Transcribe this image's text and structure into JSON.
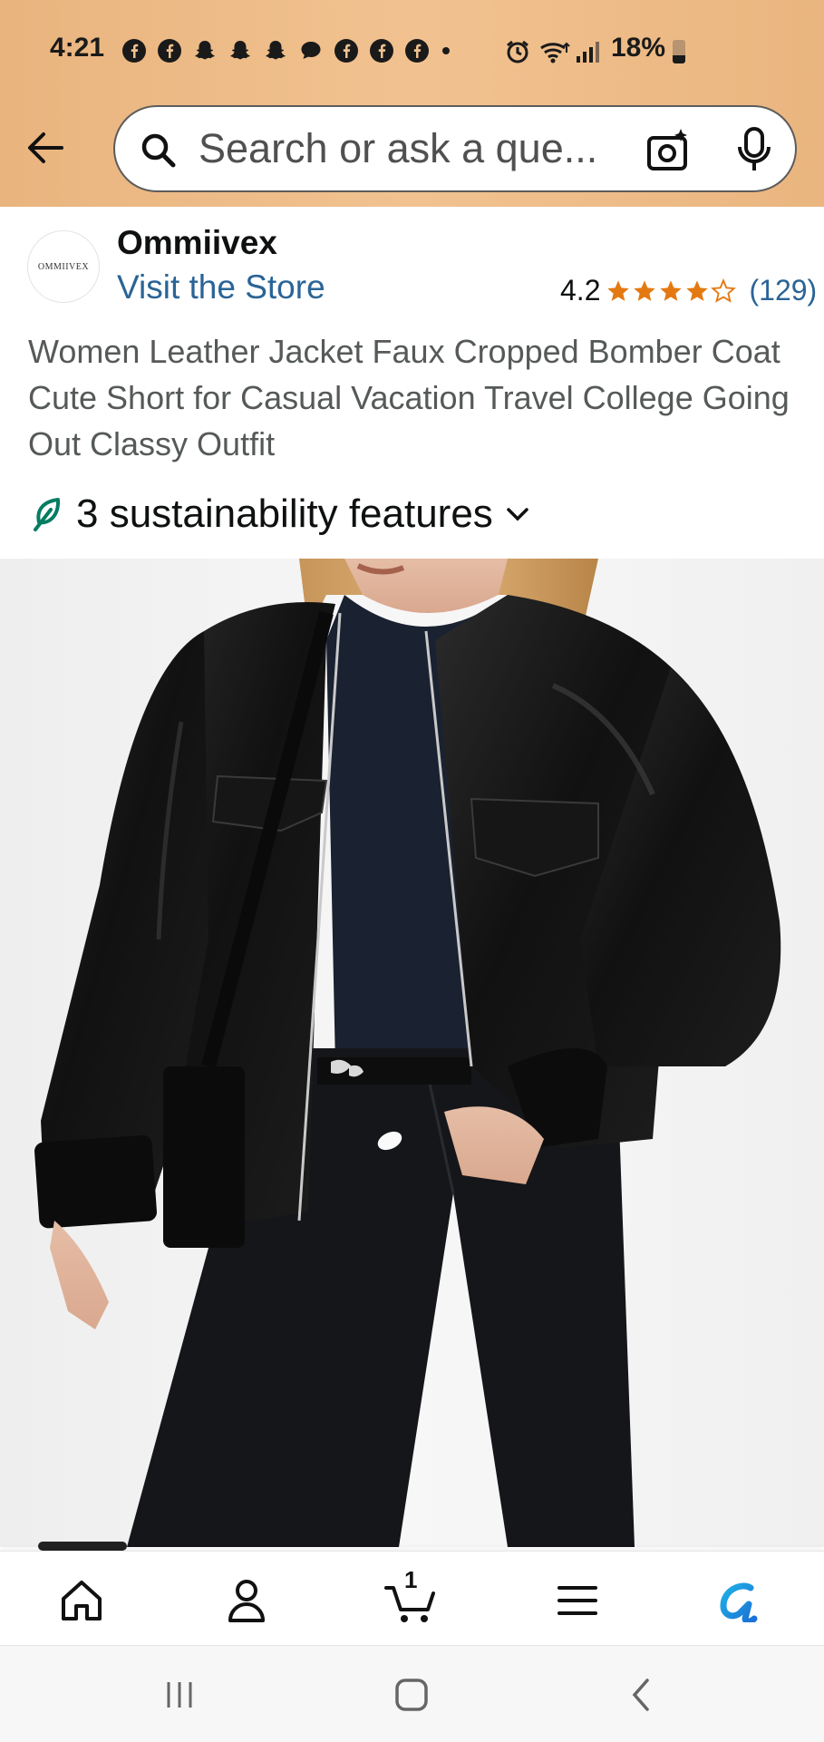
{
  "status_bar": {
    "time": "4:21",
    "battery": "18%",
    "icons": [
      "facebook-icon",
      "facebook-icon",
      "snapchat-icon",
      "snapchat-icon",
      "snapchat-icon",
      "chat-icon",
      "facebook-icon",
      "facebook-icon",
      "facebook-icon",
      "dot-icon",
      "alarm-icon",
      "wifi-icon",
      "signal-icon",
      "battery-icon"
    ]
  },
  "search": {
    "placeholder": "Search or ask a que..."
  },
  "brand": {
    "logo_text": "OMMIIVEX",
    "name": "Ommiivex",
    "visit_store": "Visit the Store",
    "rating": "4.2",
    "stars": 4.2,
    "rating_count": "(129)"
  },
  "product": {
    "title": "Women Leather Jacket Faux Cropped Bomber Coat Cute Short for Casual Vacation Travel College Going Out Classy Outfit",
    "sustainability": "3 sustainability features"
  },
  "bottom_nav": {
    "cart_count": "1",
    "items": [
      "home-icon",
      "account-icon",
      "cart-icon",
      "menu-icon",
      "rufus-icon"
    ]
  },
  "colors": {
    "header_bg": "#f1c290",
    "link": "#2a6496",
    "star": "#e47911",
    "leaf": "#067d62"
  }
}
